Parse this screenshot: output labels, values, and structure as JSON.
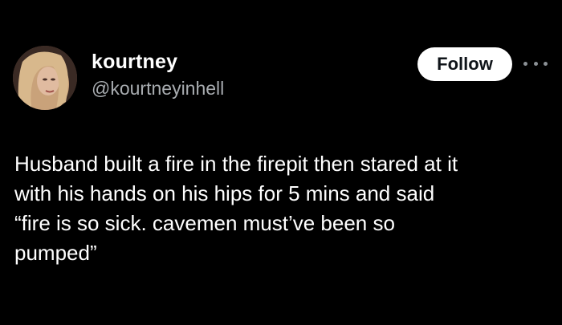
{
  "author": {
    "display_name": "kourtney",
    "handle": "@kourtneyinhell",
    "avatar_icon": "profile-photo"
  },
  "actions": {
    "follow_label": "Follow",
    "more_icon": "more-horizontal-icon"
  },
  "tweet": {
    "text": "Husband built a fire in the firepit then stared at it\nwith his hands on his hips for 5 mins and said\n“fire is so sick. cavemen must’ve been so\npumped”"
  },
  "colors": {
    "background": "#000000",
    "text": "#ffffff",
    "secondary_text": "#a8acb0",
    "button_bg": "#ffffff",
    "button_text": "#0f1419"
  }
}
